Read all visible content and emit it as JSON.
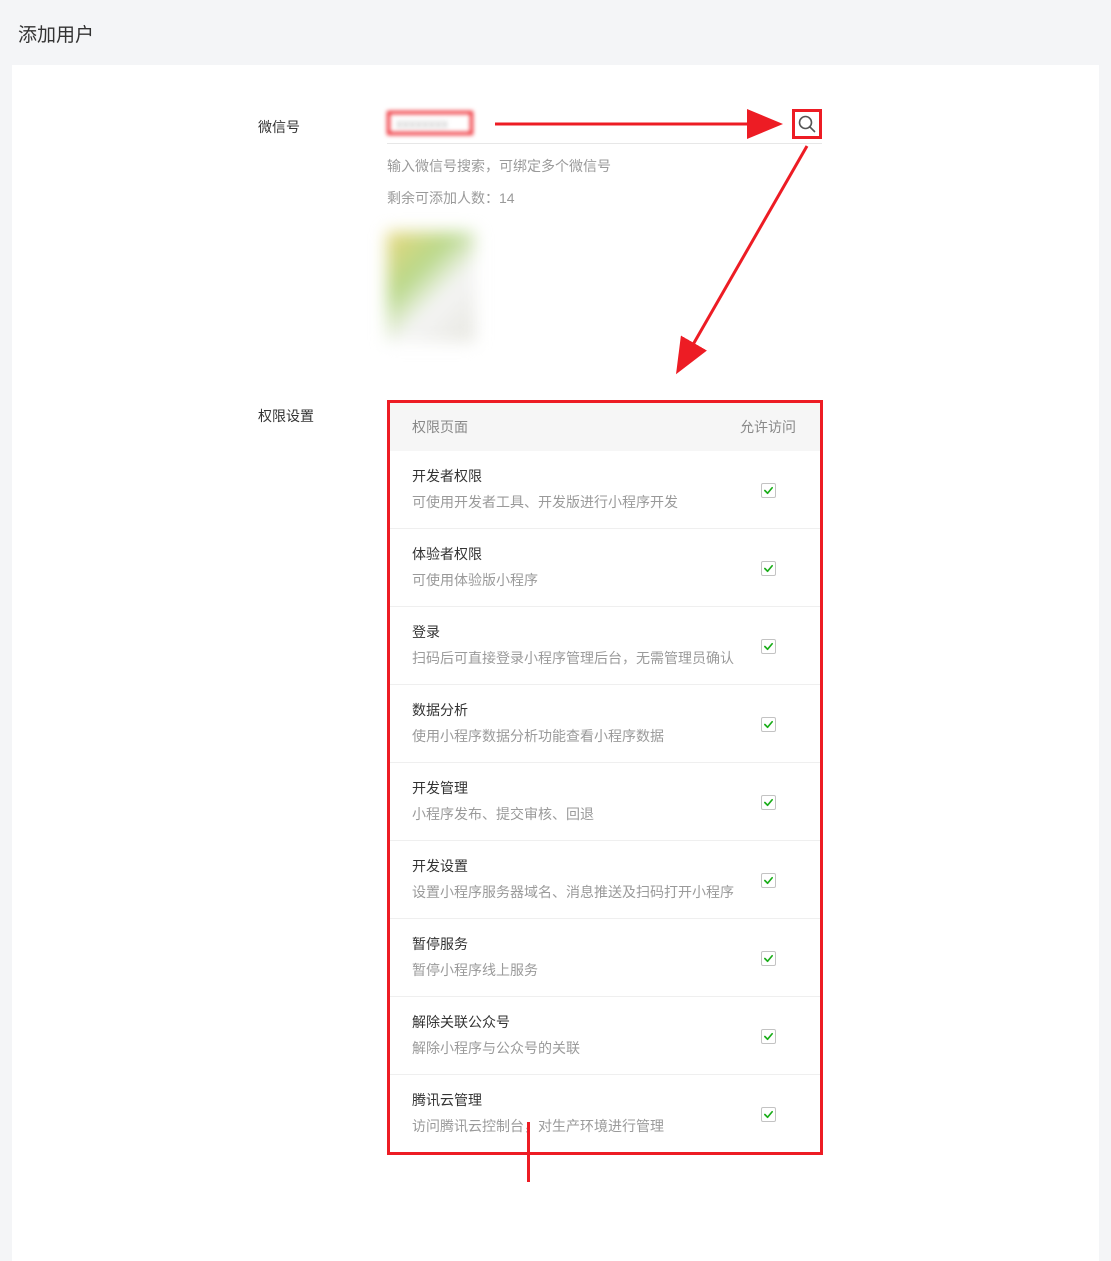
{
  "page_title": "添加用户",
  "wechat_section": {
    "label": "微信号",
    "input_value_blurred": "xxxxxxxx",
    "search_placeholder": "",
    "hint1": "输入微信号搜索，可绑定多个微信号",
    "hint2_prefix": "剩余可添加人数：",
    "remaining_count": "14"
  },
  "permissions": {
    "label": "权限设置",
    "header_left": "权限页面",
    "header_right": "允许访问",
    "items": [
      {
        "title": "开发者权限",
        "desc": "可使用开发者工具、开发版进行小程序开发",
        "checked": true
      },
      {
        "title": "体验者权限",
        "desc": "可使用体验版小程序",
        "checked": true
      },
      {
        "title": "登录",
        "desc": "扫码后可直接登录小程序管理后台，无需管理员确认",
        "checked": true
      },
      {
        "title": "数据分析",
        "desc": "使用小程序数据分析功能查看小程序数据",
        "checked": true
      },
      {
        "title": "开发管理",
        "desc": "小程序发布、提交审核、回退",
        "checked": true
      },
      {
        "title": "开发设置",
        "desc": "设置小程序服务器域名、消息推送及扫码打开小程序",
        "checked": true
      },
      {
        "title": "暂停服务",
        "desc": "暂停小程序线上服务",
        "checked": true
      },
      {
        "title": "解除关联公众号",
        "desc": "解除小程序与公众号的关联",
        "checked": true
      },
      {
        "title": "腾讯云管理",
        "desc": "访问腾讯云控制台，对生产环境进行管理",
        "checked": true
      }
    ]
  },
  "annotation_color": "#ed1c24"
}
